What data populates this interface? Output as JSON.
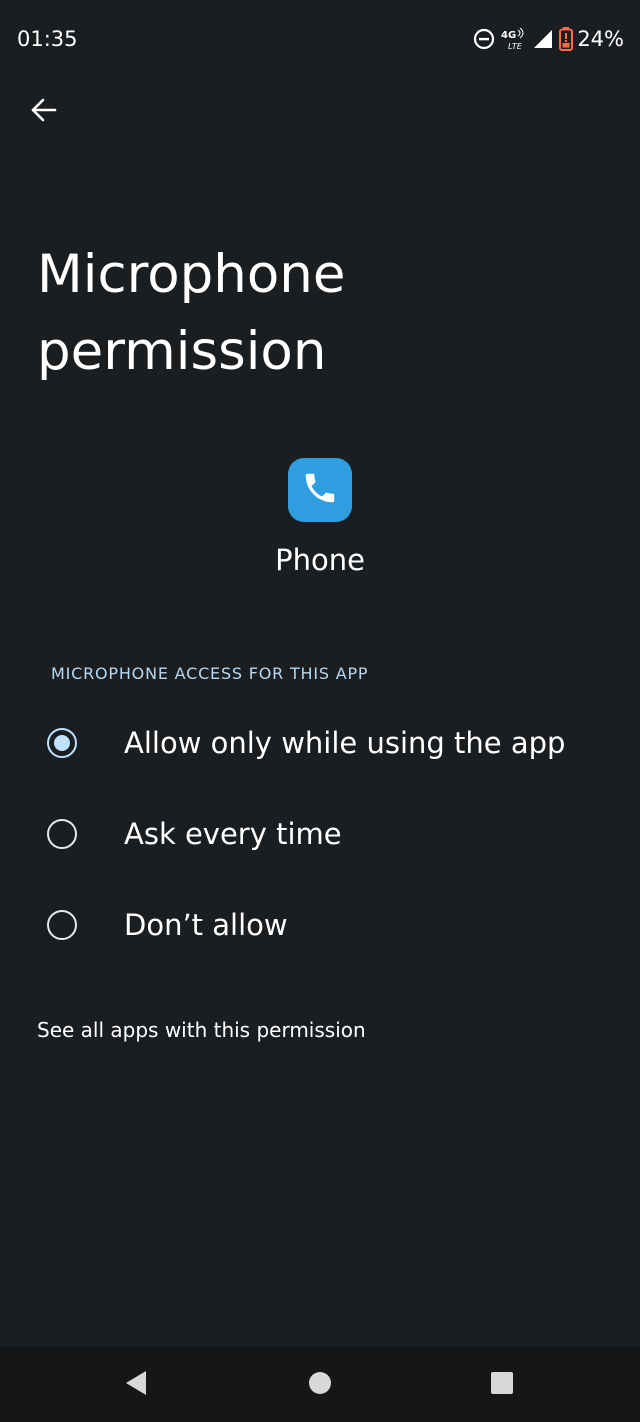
{
  "status_bar": {
    "time": "01:35",
    "battery_percent": "24%",
    "network": "4G LTE",
    "icons": [
      "do-not-disturb-icon",
      "4g-lte-icon",
      "signal-icon",
      "battery-icon"
    ]
  },
  "header": {
    "back_icon": "arrow-back-icon"
  },
  "title": "Microphone permission",
  "app": {
    "name": "Phone",
    "icon": "phone-icon",
    "icon_color": "#2f9ee0"
  },
  "section": {
    "header": "MICROPHONE ACCESS FOR THIS APP"
  },
  "options": [
    {
      "label": "Allow only while using the app",
      "selected": true
    },
    {
      "label": "Ask every time",
      "selected": false
    },
    {
      "label": "Don’t allow",
      "selected": false
    }
  ],
  "link": {
    "label": "See all apps with this permission"
  },
  "nav": {
    "icons": [
      "nav-back-icon",
      "nav-home-icon",
      "nav-recents-icon"
    ]
  },
  "colors": {
    "background": "#1b1e21",
    "accent": "#bfe2ff",
    "section_header": "#b6d8f2",
    "battery_low": "#ff6a4d"
  }
}
